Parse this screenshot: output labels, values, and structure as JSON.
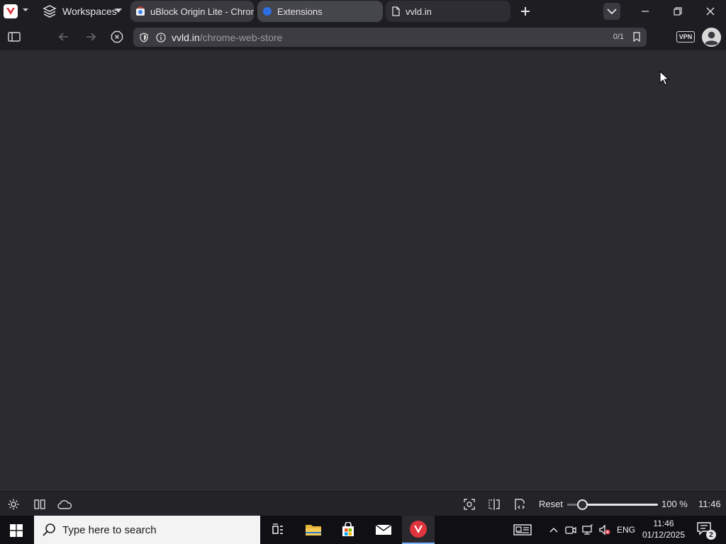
{
  "browser": {
    "workspaces_label": "Workspaces",
    "tabs": [
      {
        "title": "uBlock Origin Lite - Chrome Web Store",
        "active": false
      },
      {
        "title": "Extensions",
        "active": true
      },
      {
        "title": "vvld.in",
        "active": false
      }
    ],
    "address": {
      "domain": "vvld.in",
      "path": "/chrome-web-store",
      "counter": "0/1"
    },
    "vpn_label": "VPN"
  },
  "statusbar": {
    "reset_label": "Reset",
    "zoom_value": 100,
    "zoom_text": "100 %",
    "clock": "11:46"
  },
  "taskbar": {
    "search_placeholder": "Type here to search",
    "language": "ENG",
    "time": "11:46",
    "date": "01/12/2025",
    "notification_count": "2"
  },
  "colors": {
    "accent": "#7ab3ff",
    "vivaldi_red": "#e0343f",
    "content_bg": "#2b2b30",
    "chrome_bg": "#1e1e22"
  },
  "icons": [
    "vivaldi-menu-icon",
    "workspaces-icon",
    "chevron-down-icon",
    "new-tab-icon",
    "tab-list-icon",
    "minimize-icon",
    "maximize-icon",
    "close-icon",
    "panel-toggle-icon",
    "back-icon",
    "forward-icon",
    "stop-icon",
    "shield-icon",
    "info-icon",
    "bookmark-icon",
    "vpn-icon",
    "avatar-icon",
    "settings-icon",
    "tile-icon",
    "sync-icon",
    "capture-icon",
    "page-actions-icon",
    "reader-icon",
    "windows-start-icon",
    "search-icon",
    "task-view-icon",
    "file-explorer-icon",
    "store-icon",
    "mail-icon",
    "vivaldi-icon",
    "news-icon",
    "tray-up-icon",
    "meet-icon",
    "network-icon",
    "volume-icon",
    "notification-icon"
  ]
}
